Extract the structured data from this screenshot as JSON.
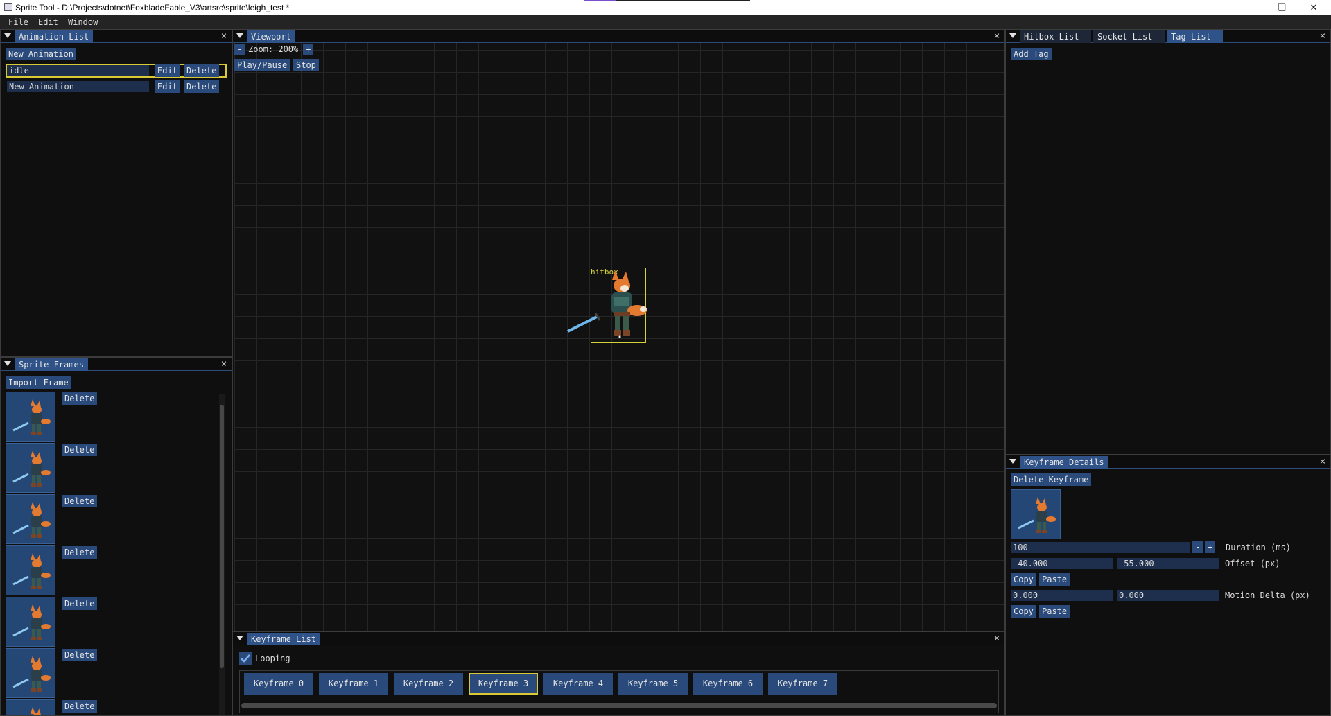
{
  "window": {
    "title": "Sprite Tool - D:\\Projects\\dotnet\\FoxbladeFable_V3\\artsrc\\sprite\\leigh_test *",
    "accent_color": "#7b4fd0"
  },
  "menu": [
    "File",
    "Edit",
    "Window"
  ],
  "animation_list": {
    "title": "Animation List",
    "new_button": "New Animation",
    "items": [
      {
        "name": "idle",
        "edit": "Edit",
        "delete": "Delete",
        "selected": true
      },
      {
        "name": "New Animation",
        "edit": "Edit",
        "delete": "Delete",
        "selected": false
      }
    ]
  },
  "sprite_frames": {
    "title": "Sprite Frames",
    "import_button": "Import Frame",
    "delete_label": "Delete",
    "frame_count_visible": 7
  },
  "viewport": {
    "title": "Viewport",
    "zoom_minus": "-",
    "zoom_label": "Zoom: 200%",
    "zoom_plus": "+",
    "play_pause": "Play/Pause",
    "stop": "Stop",
    "hitbox_label": "hitbox",
    "hitbox_color": "#d6d23a"
  },
  "keyframe_list": {
    "title": "Keyframe List",
    "looping_label": "Looping",
    "looping_checked": true,
    "keyframes": [
      "Keyframe 0",
      "Keyframe 1",
      "Keyframe 2",
      "Keyframe 3",
      "Keyframe 4",
      "Keyframe 5",
      "Keyframe 6",
      "Keyframe 7"
    ],
    "selected_index": 3
  },
  "right_tabs": {
    "tabs": [
      "Hitbox List",
      "Socket List",
      "Tag List"
    ],
    "active_tab": "Tag List",
    "add_tag": "Add Tag"
  },
  "keyframe_details": {
    "title": "Keyframe Details",
    "delete_button": "Delete Keyframe",
    "duration_value": "100",
    "duration_minus": "-",
    "duration_plus": "+",
    "duration_label": "Duration (ms)",
    "offset_x": "-40.000",
    "offset_y": "-55.000",
    "offset_label": "Offset (px)",
    "copy": "Copy",
    "paste": "Paste",
    "motion_x": "0.000",
    "motion_y": "0.000",
    "motion_label": "Motion Delta (px)"
  },
  "icons": {
    "window_minimize": "minimize-icon",
    "window_restore": "restore-icon",
    "window_close": "close-icon"
  }
}
